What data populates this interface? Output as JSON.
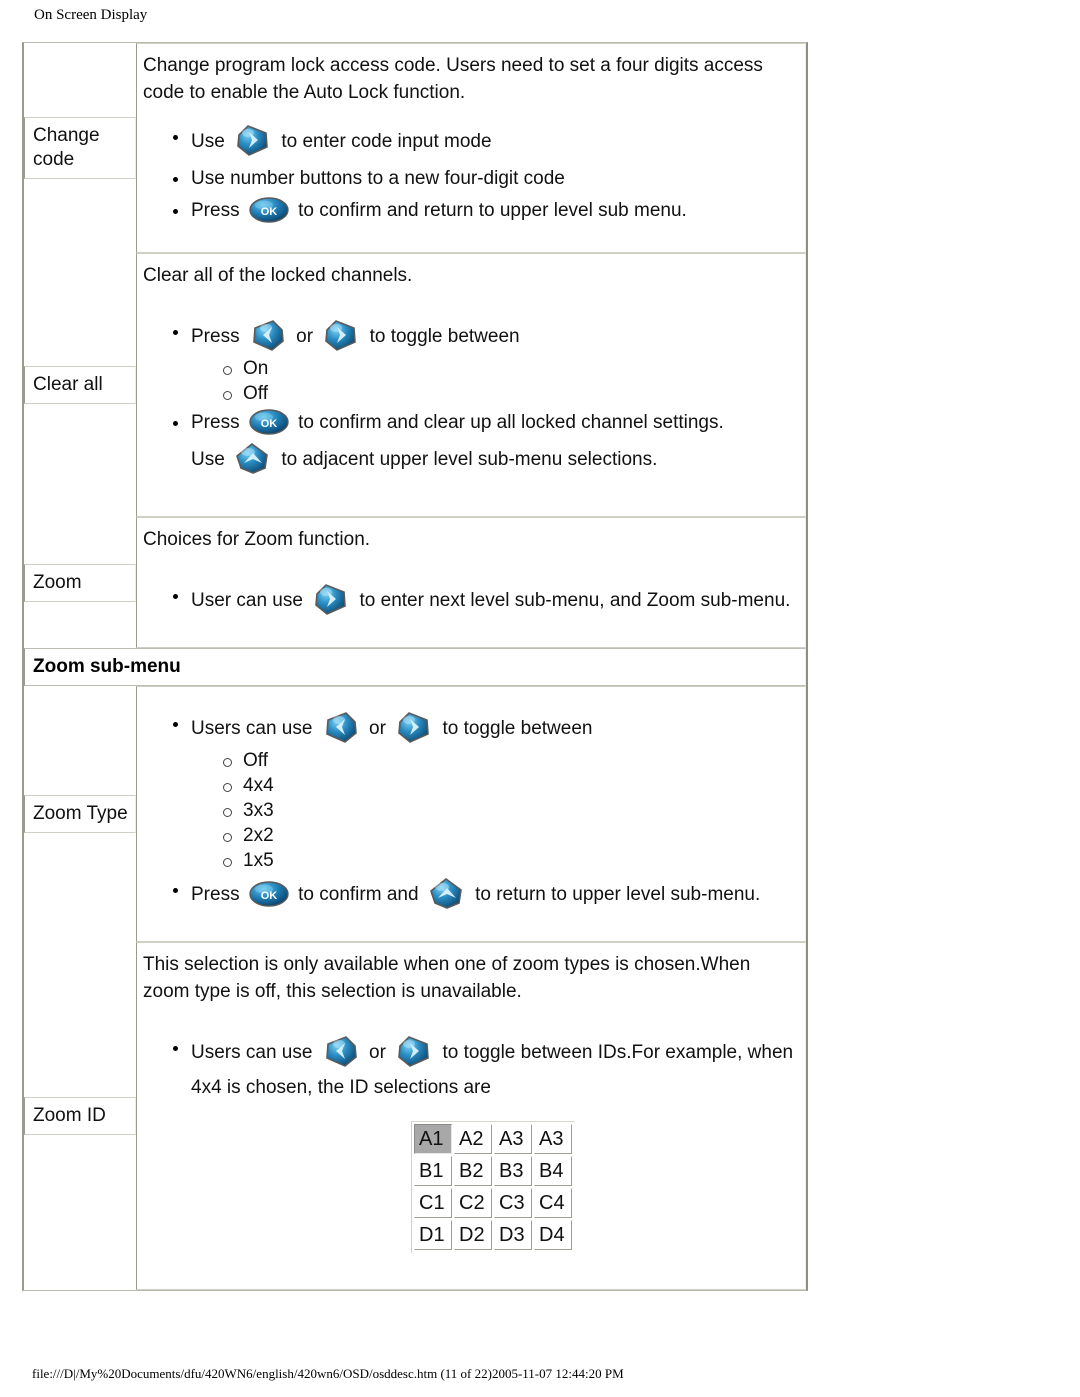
{
  "page": {
    "header": "On Screen Display",
    "footer": "file:///D|/My%20Documents/dfu/420WN6/english/420wn6/OSD/osddesc.htm (11 of 22)2005-11-07 12:44:20 PM"
  },
  "icons": {
    "right": "right-arrow-key-icon",
    "left": "left-arrow-key-icon",
    "up": "up-arrow-key-icon",
    "ok": "ok-key-icon",
    "ok_label": "OK"
  },
  "colors": {
    "key_blue_light": "#4aa8d8",
    "key_blue": "#1b6fa8",
    "key_blue_dark": "#0d3f63",
    "key_outline": "#6b6b6b",
    "grid_selected": "#a8a8a8",
    "table_border": "#9a9a8e"
  },
  "rows": [
    {
      "label": "Change code",
      "intro": "Change program lock access code.   Users need to set a four digits access code to enable the Auto Lock function.",
      "bullets": [
        {
          "pre": "Use ",
          "icon": "right",
          "post": " to enter code input mode"
        },
        {
          "pre": "Use number buttons to a new four-digit code",
          "icon": null,
          "post": ""
        },
        {
          "pre": "Press ",
          "icon": "ok",
          "post": " to confirm and return to upper level sub menu."
        }
      ]
    },
    {
      "label": "Clear all",
      "intro": "Clear all of the locked channels.",
      "bullets": [
        {
          "pre": "Press ",
          "icon": "left",
          "mid": " or ",
          "icon2": "right",
          "post": " to toggle between"
        },
        {
          "pre": "Press ",
          "icon": "ok",
          "post": " to confirm and clear up all locked channel settings."
        }
      ],
      "sub_options": [
        "On",
        "Off"
      ],
      "trailer": {
        "pre": "Use ",
        "icon": "up",
        "post": " to adjacent upper level sub-menu selections."
      }
    },
    {
      "label": "Zoom",
      "intro": "Choices for Zoom function.",
      "bullets": [
        {
          "pre": "User can use ",
          "icon": "right",
          "post": " to enter next level sub-menu, and Zoom sub-menu."
        }
      ]
    }
  ],
  "subhead": "Zoom sub-menu",
  "subrows": [
    {
      "label": "Zoom Type",
      "bullets_top": {
        "pre": "Users can use ",
        "icon": "left",
        "mid": " or ",
        "icon2": "right",
        "post": " to toggle between"
      },
      "options": [
        "Off",
        "4x4",
        "3x3",
        "2x2",
        "1x5"
      ],
      "bullets_bottom": {
        "pre": "Press ",
        "icon": "ok",
        "mid": " to confirm and ",
        "icon2": "up",
        "post": " to return to upper level sub-menu."
      }
    },
    {
      "label": "Zoom ID",
      "intro": "This selection is only available when one of zoom types is chosen.When zoom type is off, this selection is unavailable.",
      "bullet": {
        "pre": "Users can use ",
        "icon": "left",
        "mid": " or ",
        "icon2": "right",
        "post": " to toggle between IDs.For example, when 4x4 is chosen, the ID selections are"
      },
      "grid": {
        "selected": "A1",
        "rows": [
          [
            "A1",
            "A2",
            "A3",
            "A3"
          ],
          [
            "B1",
            "B2",
            "B3",
            "B4"
          ],
          [
            "C1",
            "C2",
            "C3",
            "C4"
          ],
          [
            "D1",
            "D2",
            "D3",
            "D4"
          ]
        ]
      }
    }
  ]
}
